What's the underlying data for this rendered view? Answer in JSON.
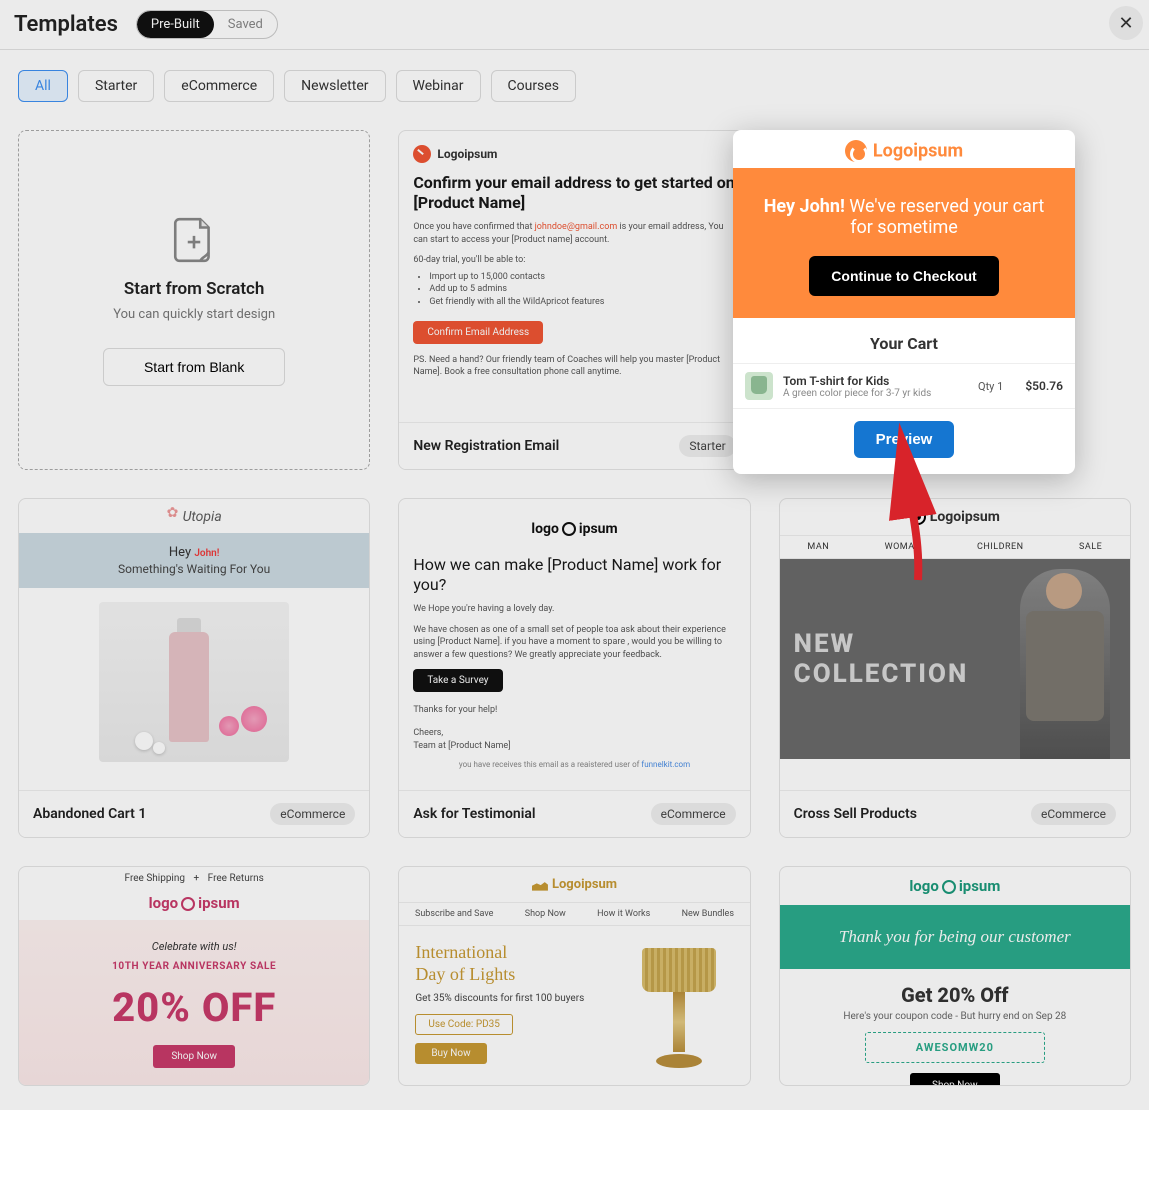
{
  "header": {
    "title": "Templates",
    "tab_prebuilt": "Pre-Built",
    "tab_saved": "Saved"
  },
  "close_icon": "✕",
  "filters": [
    "All",
    "Starter",
    "eCommerce",
    "Newsletter",
    "Webinar",
    "Courses"
  ],
  "scratch": {
    "title": "Start from Scratch",
    "sub": "You can quickly start design",
    "button": "Start from Blank"
  },
  "highlight": {
    "brand": "Logoipsum",
    "greeting_bold": "Hey John!",
    "greeting_rest": " We've reserved your cart for sometime",
    "cta": "Continue to Checkout",
    "cart_title": "Your Cart",
    "product_name": "Tom T-shirt for Kids",
    "product_desc": "A green color piece for 3-7 yr kids",
    "qty": "Qty 1",
    "price": "$50.76",
    "preview": "Preview"
  },
  "cards": {
    "reg": {
      "name": "New Registration Email",
      "badge": "Starter",
      "brand": "Logoipsum",
      "headline": "Confirm your email address to get started on [Product Name]",
      "intro_pre": "Once you have confirmed that ",
      "intro_email": "johndoe@gmail.com",
      "intro_post": " is  your email address, You can start to access your [Product name] account.",
      "trial_lead": "60-day trial, you'll be able to:",
      "bullets": [
        "Import up to 15,000 contacts",
        "Add up to 5 admins",
        "Get friendly with all the WildApricot features"
      ],
      "confirm": "Confirm Email Address",
      "ps": "PS. Need a hand? Our friendly team of Coaches will help you master [Product Name]. Book a free consultation phone call anytime."
    },
    "abandoned": {
      "name": "Abandoned Cart 1",
      "badge": "eCommerce",
      "brand": "Utopia",
      "hey": "Hey ",
      "john": "John!",
      "sub": "Something's Waiting For You"
    },
    "ask": {
      "name": "Ask for Testimonial",
      "badge": "eCommerce",
      "brand_pre": "logo",
      "brand_post": "ipsum",
      "headline": "How we can make [Product Name] work for you?",
      "hope": "We Hope you're having a lovely day.",
      "body": "We have chosen as one of a small set of people toa ask about their  experience using [Product Name].  if you have a moment to spare , would you be willing to answer a few questions? We greatly appreciate your feedback.",
      "survey": "Take a Survey",
      "thanks": "Thanks for your help!",
      "cheers": "Cheers,",
      "team": "Team at [Product Name]",
      "footer_pre": "you have receives this email as a reaistered user of ",
      "footer_link": "funnelkit.com"
    },
    "cross": {
      "name": "Cross Sell Products",
      "badge": "eCommerce",
      "brand": "Logoipsum",
      "nav": [
        "MAN",
        "WOMAN",
        "CHILDREN",
        "SALE"
      ],
      "l1": "NEW",
      "l2": "COLLECTION"
    },
    "sale": {
      "ship": "Free Shipping",
      "plus": "+",
      "returns": "Free Returns",
      "brand_pre": "logo",
      "brand_post": "ipsum",
      "celebrate": "Celebrate with us!",
      "ann": "10TH YEAR ANNIVERSARY SALE",
      "pct": "20% OFF",
      "shop": "Shop Now"
    },
    "lamp": {
      "brand": "Logoipsum",
      "nav": [
        "Subscribe and Save",
        "Shop Now",
        "How it Works",
        "New Bundles"
      ],
      "h1": "International",
      "h2": "Day of Lights",
      "sub": "Get 35% discounts for first 100 buyers",
      "code": "Use Code: PD35",
      "buy": "Buy Now"
    },
    "thankyou": {
      "brand_pre": "logo",
      "brand_post": "ipsum",
      "hero": "Thank you for being our customer",
      "h": "Get 20% Off",
      "sub": "Here's your coupon code - But hurry end on  Sep 28",
      "code": "AWESOMW20",
      "shop": "Shop Now"
    }
  }
}
